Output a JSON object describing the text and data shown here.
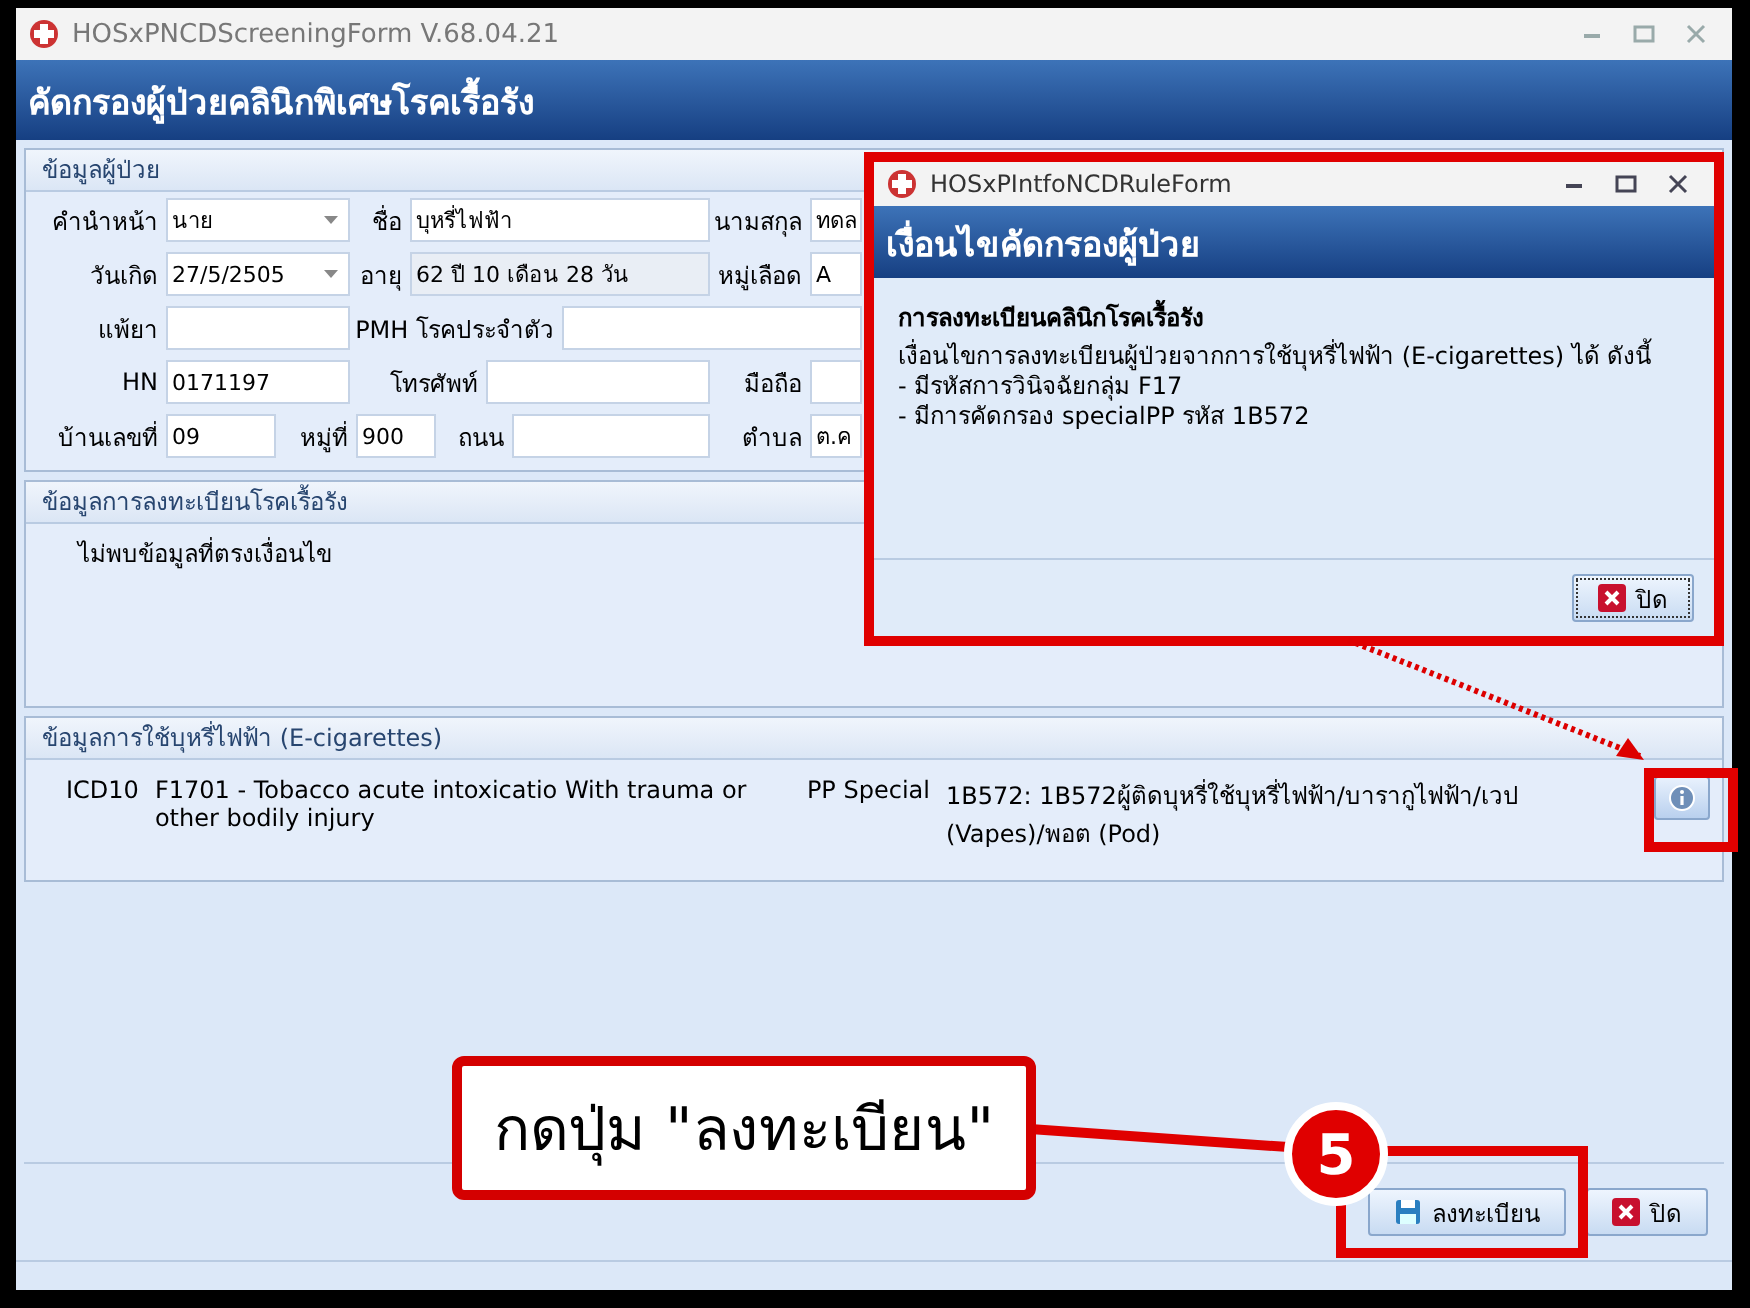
{
  "window": {
    "title": "HOSxPNCDScreeningForm V.68.04.21"
  },
  "header": {
    "title": "คัดกรองผู้ป่วยคลินิกพิเศษโรคเรื้อรัง"
  },
  "patient_panel": {
    "title": "ข้อมูลผู้ป่วย",
    "fields": [
      {
        "label": "คำนำหน้า",
        "value": "นาย",
        "kind": "combo"
      },
      {
        "label": "ชื่อ",
        "value": "บุหรี่ไฟฟ้า",
        "kind": "text"
      },
      {
        "label": "นามสกุล",
        "value": "ทดล",
        "kind": "text"
      },
      {
        "label": "วันเกิด",
        "value": "27/5/2505",
        "kind": "combo"
      },
      {
        "label": "อายุ",
        "value": "62 ปี 10 เดือน 28 วัน",
        "kind": "readonly"
      },
      {
        "label": "หมู่เลือด",
        "value": "A",
        "kind": "text"
      },
      {
        "label": "แพ้ยา",
        "kind": "text"
      },
      {
        "label": "PMH โรคประจำตัว",
        "kind": "text"
      },
      {
        "label": "HN",
        "value": "0171197",
        "kind": "text"
      },
      {
        "label": "โทรศัพท์",
        "kind": "text"
      },
      {
        "label": "มือถือ",
        "kind": "text"
      },
      {
        "label": "บ้านเลขที่",
        "value": "09",
        "kind": "text"
      },
      {
        "label": "หมู่ที่",
        "value": "900",
        "kind": "text"
      },
      {
        "label": "ถนน",
        "kind": "text"
      },
      {
        "label": "ตำบล",
        "value": "ต.ค",
        "kind": "text"
      }
    ]
  },
  "registration_panel": {
    "title": "ข้อมูลการลงทะเบียนโรคเรื้อรัง",
    "message": "ไม่พบข้อมูลที่ตรงเงื่อนไข"
  },
  "ecig_panel": {
    "title": "ข้อมูลการใช้บุหรี่ไฟฟ้า (E-cigarettes)",
    "icd_label": "ICD10",
    "icd_value": "F1701 - Tobacco acute intoxicatio With trauma or other bodily injury",
    "pp_label": "PP Special",
    "pp_value": "1B572: 1B572ผู้ติดบุหรี่ใช้บุหรี่ไฟฟ้า/บารากูไฟฟ้า/เวป (Vapes)/พอต (Pod)"
  },
  "buttons": [
    {
      "label": "ลงทะเบียน",
      "kind": "save"
    },
    {
      "label": "ปิด",
      "kind": "close"
    }
  ],
  "dialog": {
    "title": "HOSxPIntfoNCDRuleForm",
    "header": "เงื่อนไขคัดกรองผู้ป่วย",
    "heading": "การลงทะเบียนคลินิกโรคเรื้อรัง",
    "lines": [
      "เงื่อนไขการลงทะเบียนผู้ป่วยจากการใช้บุหรี่ไฟฟ้า (E-cigarettes) ได้ ดังนี้",
      "- มีรหัสการวินิจฉัยกลุ่ม F17",
      "- มีการคัดกรอง specialPP รหัส 1B572"
    ],
    "button": "ปิด"
  },
  "annotation": {
    "text": "กดปุ่ม \"ลงทะเบียน\"",
    "step": "5"
  }
}
